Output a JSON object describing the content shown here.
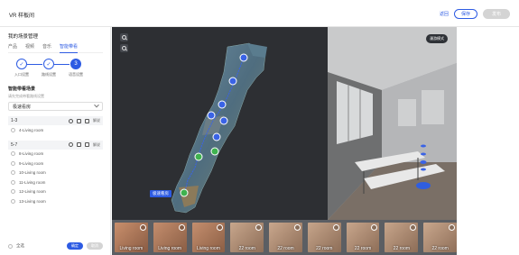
{
  "header": {
    "title": "VR 样板间",
    "link_label": "返回",
    "save_label": "保存",
    "publish_label": "发布"
  },
  "sidebar": {
    "heading": "我的场景管理",
    "tabs": [
      {
        "label": "产品",
        "active": false
      },
      {
        "label": "视频",
        "active": false
      },
      {
        "label": "音乐",
        "active": false
      },
      {
        "label": "智能带看",
        "active": true
      }
    ],
    "steps": [
      {
        "mark": "✓",
        "label": "入口设置"
      },
      {
        "mark": "✓",
        "label": "路线设置"
      },
      {
        "mark": "3",
        "label": "语音设置"
      }
    ],
    "section_title": "智能带看场景",
    "section_sub": "请先完成带看路线设置",
    "select_value": "极速看房",
    "groups": [
      {
        "name": "1-3",
        "action": "解说",
        "rooms": [
          "4-Living room"
        ]
      },
      {
        "name": "5-7",
        "action": "解说",
        "rooms": [
          "8-Living room",
          "9-Living room",
          "10-Living room",
          "11-Living room",
          "12-Living room",
          "13-Living room"
        ]
      }
    ],
    "footer_label": "全选",
    "confirm_label": "确定",
    "cancel_label": "取消"
  },
  "floorplan": {
    "current_tag": "极速看房"
  },
  "pano": {
    "badge": "漫游模式"
  },
  "thumbnails": [
    {
      "label": "Living room",
      "selected": true
    },
    {
      "label": "Living room",
      "selected": true
    },
    {
      "label": "Living room",
      "selected": true
    },
    {
      "label": "22 room",
      "selected": false
    },
    {
      "label": "22 room",
      "selected": false
    },
    {
      "label": "22 room",
      "selected": false
    },
    {
      "label": "22 room",
      "selected": false
    },
    {
      "label": "22 room",
      "selected": false
    },
    {
      "label": "22 room",
      "selected": false
    }
  ],
  "colors": {
    "accent": "#2d5be3",
    "route_blue": "#3a63e6",
    "route_green": "#3fb24f"
  }
}
